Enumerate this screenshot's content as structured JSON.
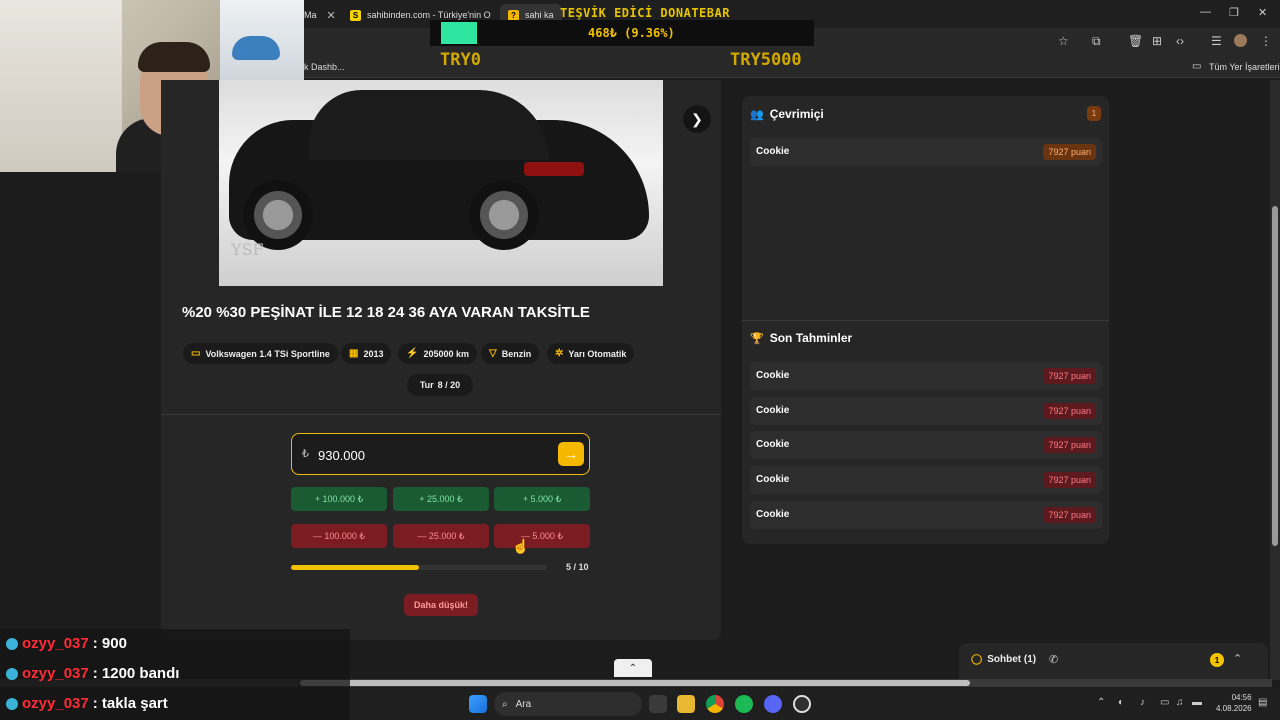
{
  "browser": {
    "tabs": [
      {
        "label": "Ma",
        "favicon": ""
      },
      {
        "label": "sahibinden.com - Türkiye'nin O",
        "favicon": "S"
      },
      {
        "label": "sahi ka",
        "favicon": "?"
      }
    ],
    "bookmarks_left": "k Dashb...",
    "bookmarks_right": "Tüm Yer İşaretleri"
  },
  "donation": {
    "title": "TEŞVİK EDİCİ DONATEBAR",
    "amount": "468₺ (9.36%)",
    "progress_fraction": 0.0936,
    "start_label": "TRY0",
    "goal_label": "TRY5000"
  },
  "listing": {
    "title": "%20 %30 PEŞİNAT İLE 12 18 24 36 AYA VARAN TAKSİTLE",
    "photo_watermark": "YSF",
    "chips": [
      {
        "icon": "car-icon",
        "glyph": "🚘",
        "label": "Volkswagen 1.4 TSi Sportline"
      },
      {
        "icon": "calendar-icon",
        "glyph": "▦",
        "label": "2013"
      },
      {
        "icon": "gauge-icon",
        "glyph": "⚡",
        "label": "205000 km"
      },
      {
        "icon": "fuel-icon",
        "glyph": "⛽",
        "label": "Benzin"
      },
      {
        "icon": "gear-icon",
        "glyph": "✲",
        "label": "Yarı Otomatik"
      }
    ],
    "round_label": "Tur",
    "round_value": "8 / 20"
  },
  "guess": {
    "currency": "₺",
    "value": "930.000",
    "plus_buttons": [
      "+ 100.000 ₺",
      "+ 25.000 ₺",
      "+ 5.000 ₺"
    ],
    "minus_buttons": [
      "— 100.000 ₺",
      "— 25.000 ₺",
      "— 5.000 ₺"
    ],
    "progress_text": "5 / 10",
    "progress_fraction": 0.5,
    "lower_button": "Daha düşük!"
  },
  "online": {
    "title": "Çevrimiçi",
    "count": "1",
    "players": [
      {
        "name": "Cookie",
        "score": "7927 puan"
      }
    ]
  },
  "recent": {
    "title": "Son Tahminler",
    "rows": [
      {
        "name": "Cookie",
        "score": "7927 puan"
      },
      {
        "name": "Cookie",
        "score": "7927 puan"
      },
      {
        "name": "Cookie",
        "score": "7927 puan"
      },
      {
        "name": "Cookie",
        "score": "7927 puan"
      },
      {
        "name": "Cookie",
        "score": "7927 puan"
      }
    ]
  },
  "chat": {
    "label": "Sohbet (1)",
    "badge": "1"
  },
  "stream_chat": [
    {
      "user": "ozyy_037",
      "message": ": 900"
    },
    {
      "user": "ozyy_037",
      "message": ": 1200 bandı"
    },
    {
      "user": "ozyy_037",
      "message": ": takla şart"
    }
  ],
  "taskbar": {
    "search_placeholder": "Ara",
    "time": "04:56",
    "date": "4.08.2026"
  },
  "colors": {
    "accent": "#f5b800",
    "plus": "#1a5b33",
    "minus": "#7a1c22",
    "donation_fill": "#2ee6a0"
  }
}
